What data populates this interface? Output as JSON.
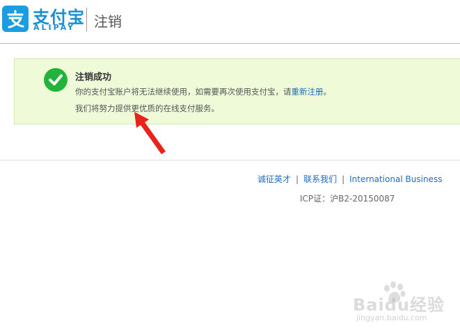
{
  "header": {
    "logo_cn": "支付宝",
    "logo_en": "ALIPAY",
    "page_title": "注销"
  },
  "notice": {
    "title": "注销成功",
    "line1_before_link": "你的支付宝账户将无法继续使用，如需要再次使用支付宝，请",
    "line1_link": "重新注册",
    "line1_after_link": "。",
    "line2": "我们将努力提供更优质的在线支付服务。"
  },
  "footer": {
    "links": [
      "诚征英才",
      "联系我们",
      "International Business"
    ],
    "separator": "|",
    "icp": "ICP证：沪B2-20150087"
  },
  "watermark": {
    "text": "Baidu经验",
    "domain": "jingyan.baidu.com"
  },
  "colors": {
    "brand": "#1a8fd6",
    "notice_bg": "#eefad8",
    "success": "#22b43a",
    "link": "#1e6bc0",
    "arrow": "#e8231a"
  }
}
